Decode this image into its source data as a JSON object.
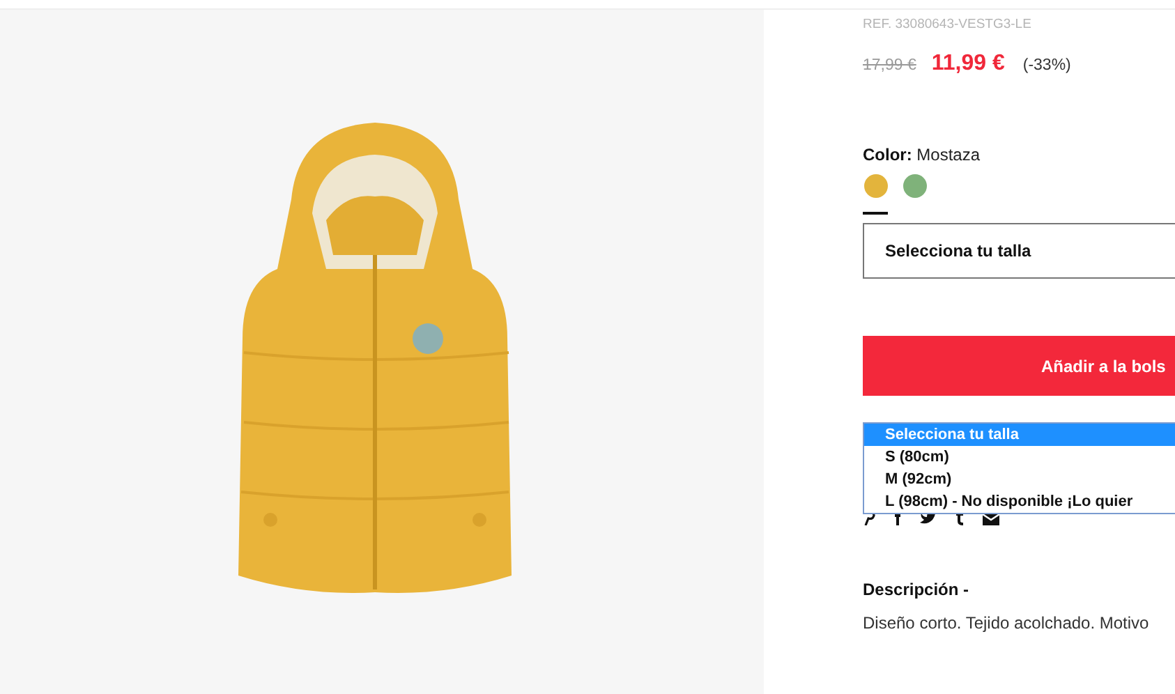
{
  "product": {
    "reference": "REF. 33080643-VESTG3-LE",
    "old_price": "17,99 €",
    "price": "11,99 €",
    "discount": "(-33%)"
  },
  "color": {
    "label": "Color:",
    "value": "Mostaza",
    "swatches": [
      {
        "color": "#e3b43c",
        "selected": true
      },
      {
        "color": "#7fb27a",
        "selected": false
      }
    ]
  },
  "size_select": {
    "value": "Selecciona tu talla",
    "options": [
      {
        "label": "Selecciona tu talla",
        "selected": true
      },
      {
        "label": "S (80cm)",
        "selected": false
      },
      {
        "label": "M (92cm)",
        "selected": false
      },
      {
        "label": "L (98cm) - No disponible ¡Lo quier",
        "selected": false
      }
    ]
  },
  "add_button": {
    "label": "Añadir a la bols"
  },
  "description": {
    "title": "Descripción -",
    "text": "Diseño corto. Tejido acolchado. Motivo"
  }
}
